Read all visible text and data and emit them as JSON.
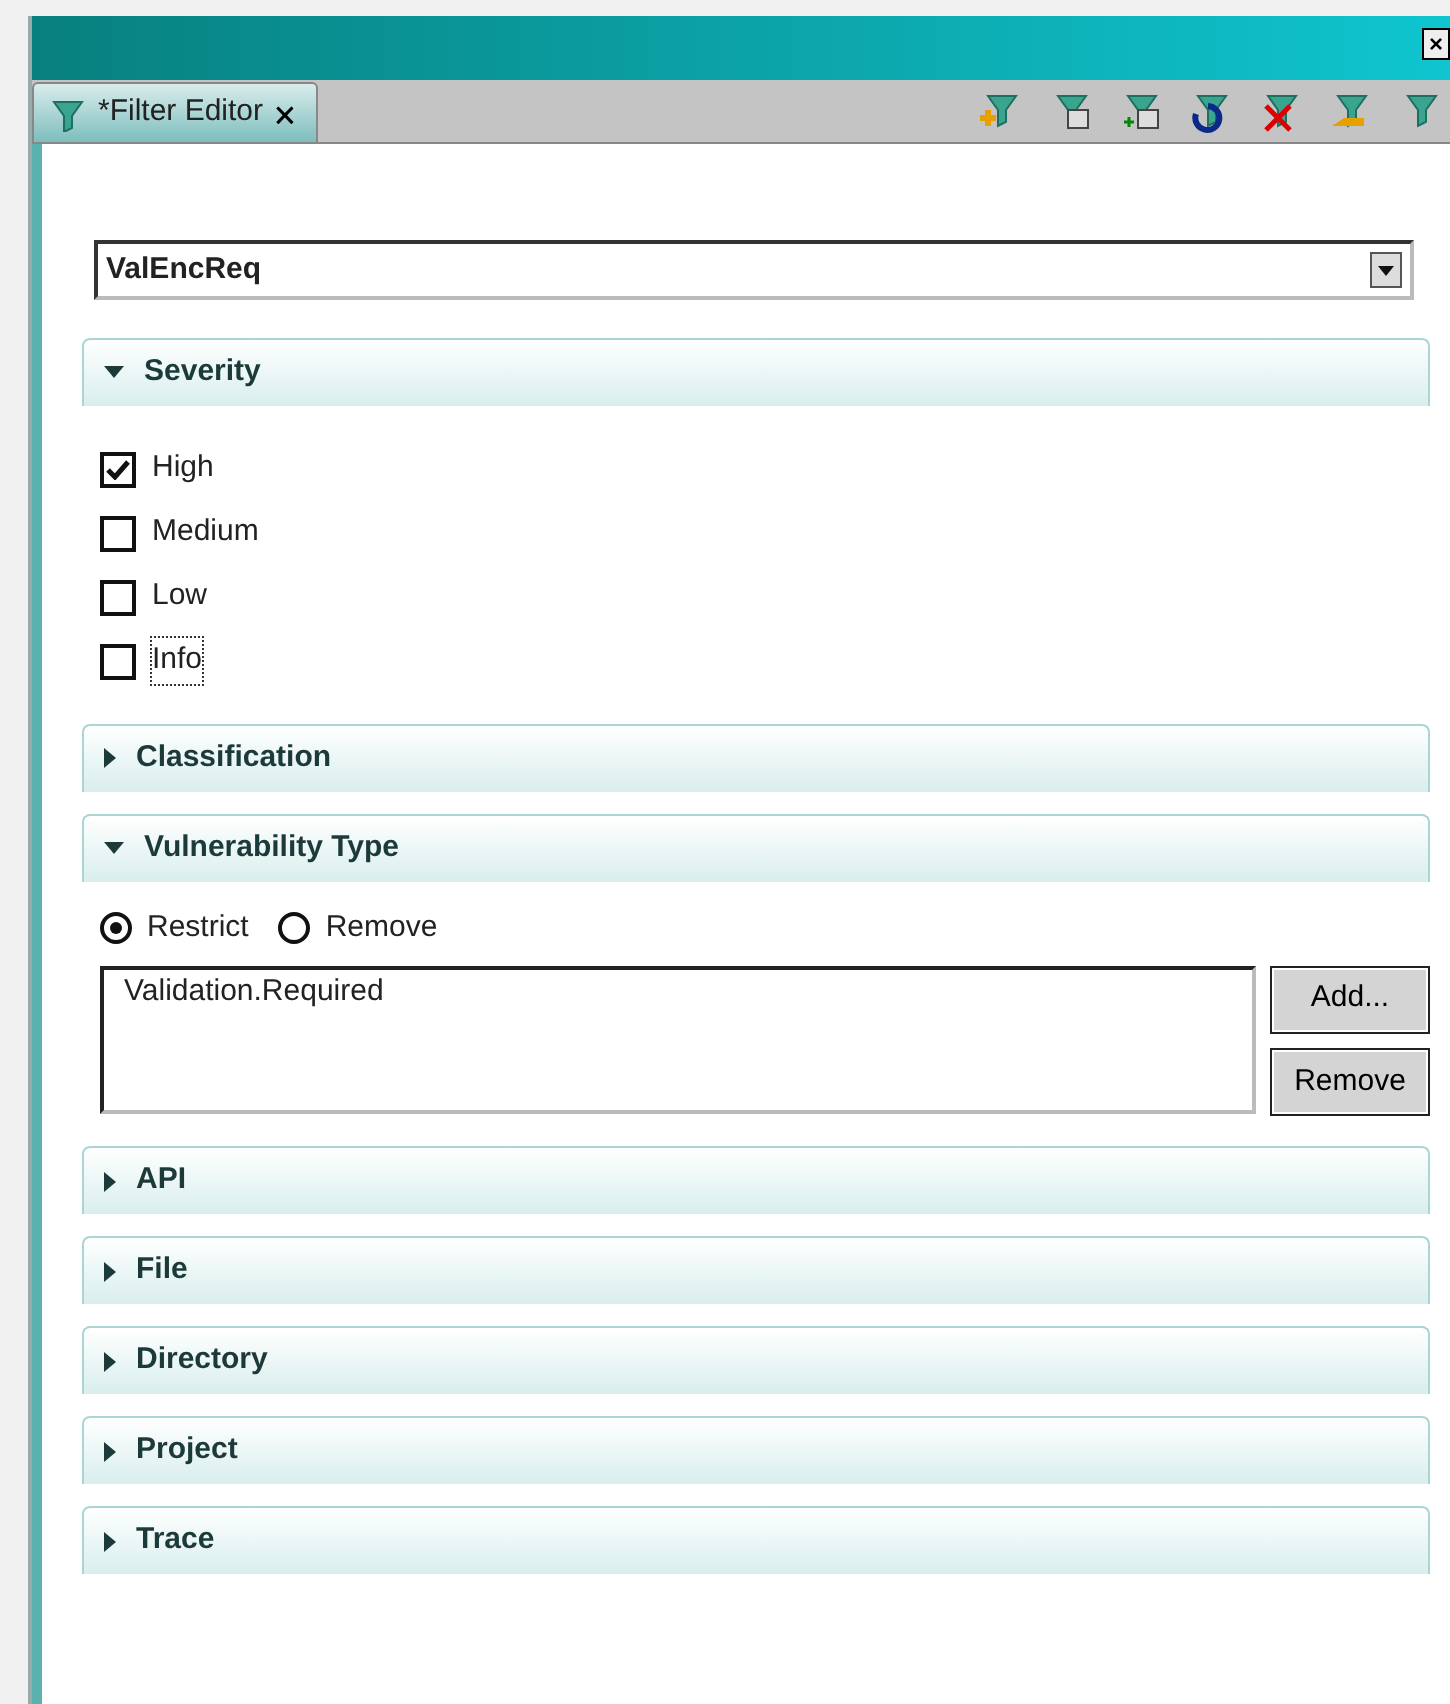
{
  "window": {
    "close": "×"
  },
  "tab": {
    "title": "*Filter Editor",
    "close": "🗙"
  },
  "filter_name": {
    "value": "ValEncReq"
  },
  "sections": [
    {
      "title": "Severity",
      "expanded": true,
      "kind": "checkboxes",
      "items": [
        {
          "label": "High",
          "checked": true,
          "focused": false
        },
        {
          "label": "Medium",
          "checked": false,
          "focused": false
        },
        {
          "label": "Low",
          "checked": false,
          "focused": false
        },
        {
          "label": "Info",
          "checked": false,
          "focused": true
        }
      ]
    },
    {
      "title": "Classification",
      "expanded": false
    },
    {
      "title": "Vulnerability Type",
      "expanded": true,
      "kind": "list",
      "modes": [
        {
          "label": "Restrict",
          "selected": true
        },
        {
          "label": "Remove",
          "selected": false
        }
      ],
      "entries": [
        "Validation.Required"
      ],
      "buttons": [
        "Add...",
        "Remove"
      ]
    },
    {
      "title": "API",
      "expanded": false
    },
    {
      "title": "File",
      "expanded": false
    },
    {
      "title": "Directory",
      "expanded": false
    },
    {
      "title": "Project",
      "expanded": false
    },
    {
      "title": "Trace",
      "expanded": false
    }
  ]
}
